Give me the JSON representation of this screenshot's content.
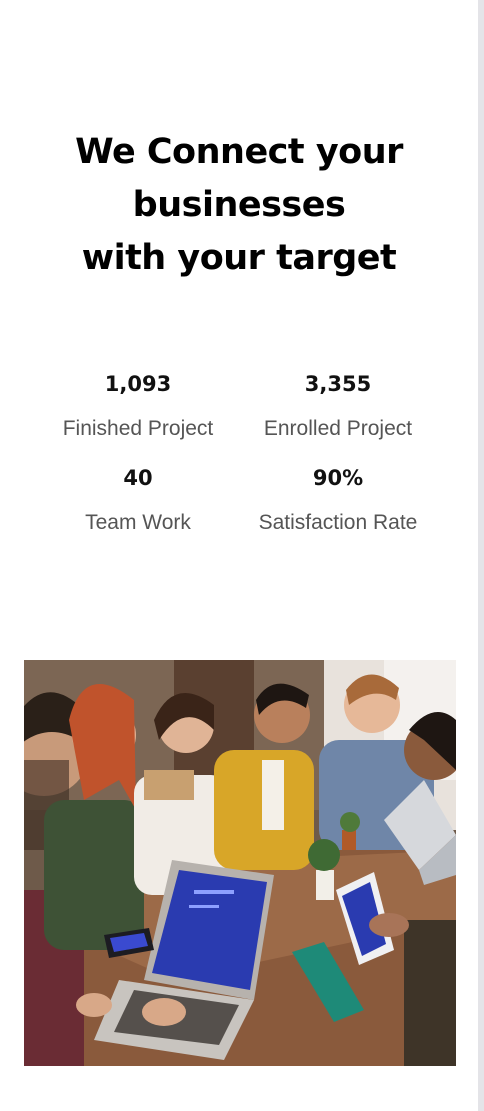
{
  "hero": {
    "line1": "We Connect your",
    "line2": "businesses",
    "line3": "with your target"
  },
  "stats": [
    {
      "value": "1,093",
      "label": "Finished Project"
    },
    {
      "value": "3,355",
      "label": "Enrolled Project"
    },
    {
      "value": "40",
      "label": "Team Work"
    },
    {
      "value": "90%",
      "label": "Satisfaction Rate"
    }
  ],
  "photo": {
    "subject": "team-meeting-photo"
  },
  "colors": {
    "title": "#000000",
    "label": "#555555",
    "table": "#8a5a3c",
    "laptop_screen": "#2a3bb0"
  }
}
